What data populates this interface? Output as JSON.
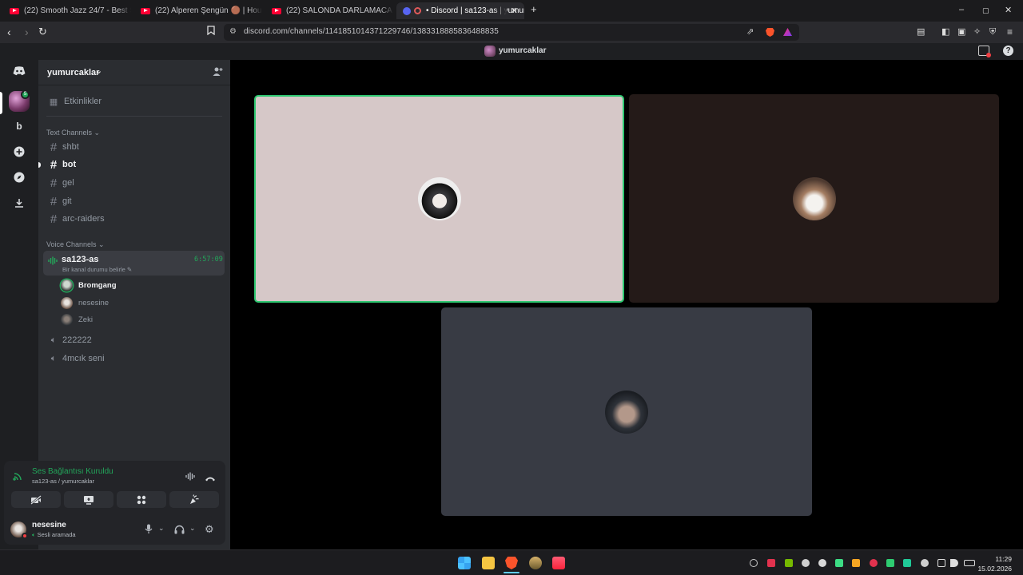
{
  "browser": {
    "tabs": [
      {
        "label": "(22) Smooth Jazz 24/7 - Best Smooth"
      },
      {
        "label": "(22) Alperen Şengün 🟤 | Houston R"
      },
      {
        "label": "(22) SALONDA DARLAMACA - YouTu"
      },
      {
        "label": "• Discord | sa123-as | yumurc"
      }
    ],
    "new_tab": "+",
    "url": "discord.com/channels/1141851014371229746/1383318885836488835",
    "window_controls": [
      "–",
      "▢",
      "✕"
    ]
  },
  "discord": {
    "title_bar": {
      "server_name": "yumurcaklar"
    },
    "rail": {
      "dm_icon": "discord-logo",
      "server_letter": "b",
      "badge": "5"
    },
    "server": {
      "name": "yumurcaklar",
      "chevron": "⌄"
    },
    "events_label": "Etkinlikler",
    "text_category": "Text Channels",
    "text_channels": [
      "shbt",
      "bot",
      "gel",
      "git",
      "arc-raiders"
    ],
    "voice_category": "Voice Channels",
    "active_voice": {
      "name": "sa123-as",
      "timer": "6:57:09",
      "status_hint": "Bir kanal durumu belirle",
      "users": [
        "Bromgang",
        "nesesine",
        "Zeki"
      ]
    },
    "other_voice": [
      "222222",
      "4mcık seni"
    ],
    "voice_panel": {
      "status": "Ses Bağlantısı Kuruldu",
      "location": "sa123-as / yumurcaklar"
    },
    "user": {
      "name": "nesesine",
      "status": "Sesli aramada"
    },
    "colors": {
      "accent_green": "#23a55a",
      "speaking_border": "#2dc770"
    }
  },
  "stage": {
    "tiles": [
      {
        "user": "Bromgang",
        "bg": "#d6c8c8",
        "speaking": true
      },
      {
        "user": "nesesine",
        "bg": "#241a18",
        "speaking": false
      },
      {
        "user": "Zeki",
        "bg": "#383b44",
        "speaking": false
      }
    ]
  },
  "taskbar": {
    "time": "11:29",
    "date": "15.02.2026"
  }
}
